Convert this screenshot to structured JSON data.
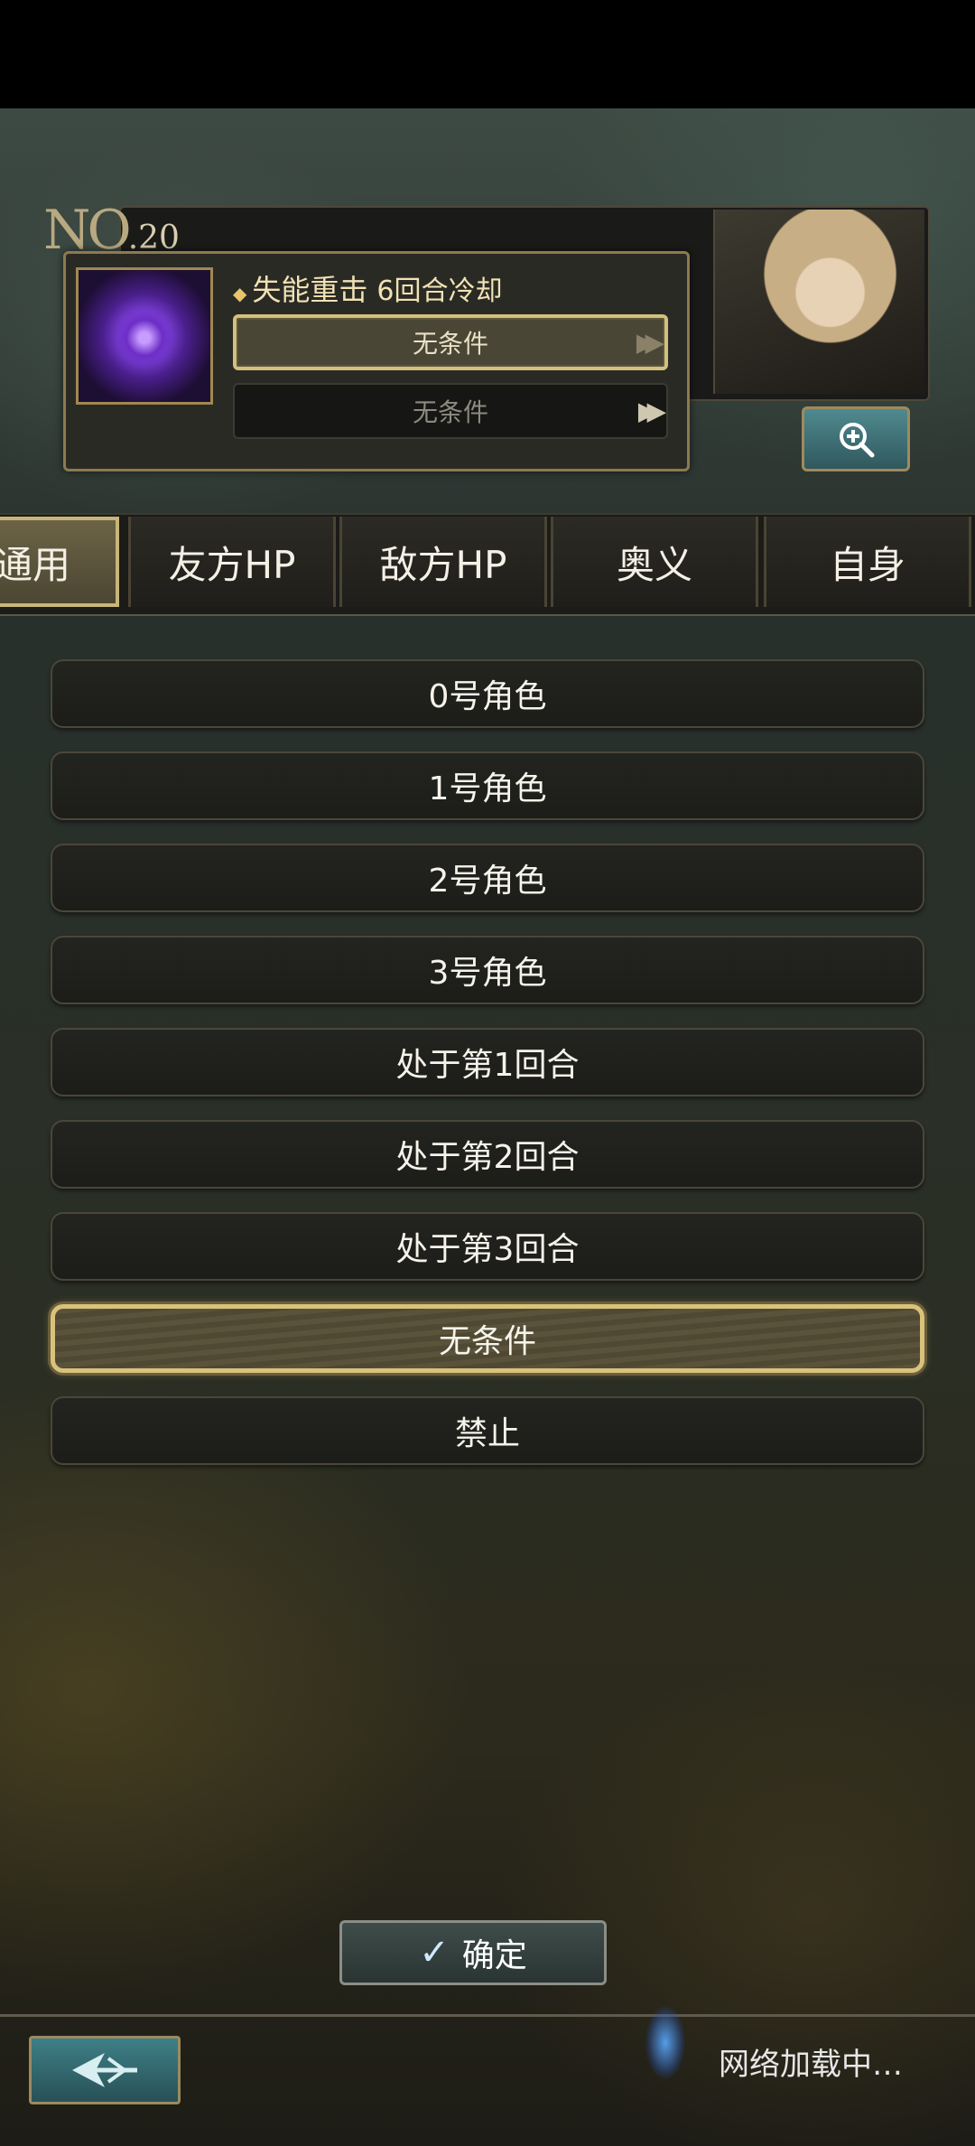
{
  "header": {
    "no_prefix": "NO",
    "no_number": ".20",
    "skill_name": "失能重击",
    "skill_cooldown": "6回合冷却",
    "condition_1": "无条件",
    "condition_2": "无条件"
  },
  "tabs": [
    "通用",
    "友方HP",
    "敌方HP",
    "奥义",
    "自身"
  ],
  "active_tab": "通用",
  "options": [
    "0号角色",
    "1号角色",
    "2号角色",
    "3号角色",
    "处于第1回合",
    "处于第2回合",
    "处于第3回合",
    "无条件",
    "禁止"
  ],
  "selected_option": "无条件",
  "confirm_label": "确定",
  "loading_text": "网络加载中…",
  "icons": {
    "zoom": "zoom-in-icon",
    "back": "back-arrow-icon",
    "check": "check-icon",
    "arrow": "double-chevron-right-icon"
  },
  "colors": {
    "gold_border": "#d9c27c",
    "teal_button": "#3e7f86"
  }
}
